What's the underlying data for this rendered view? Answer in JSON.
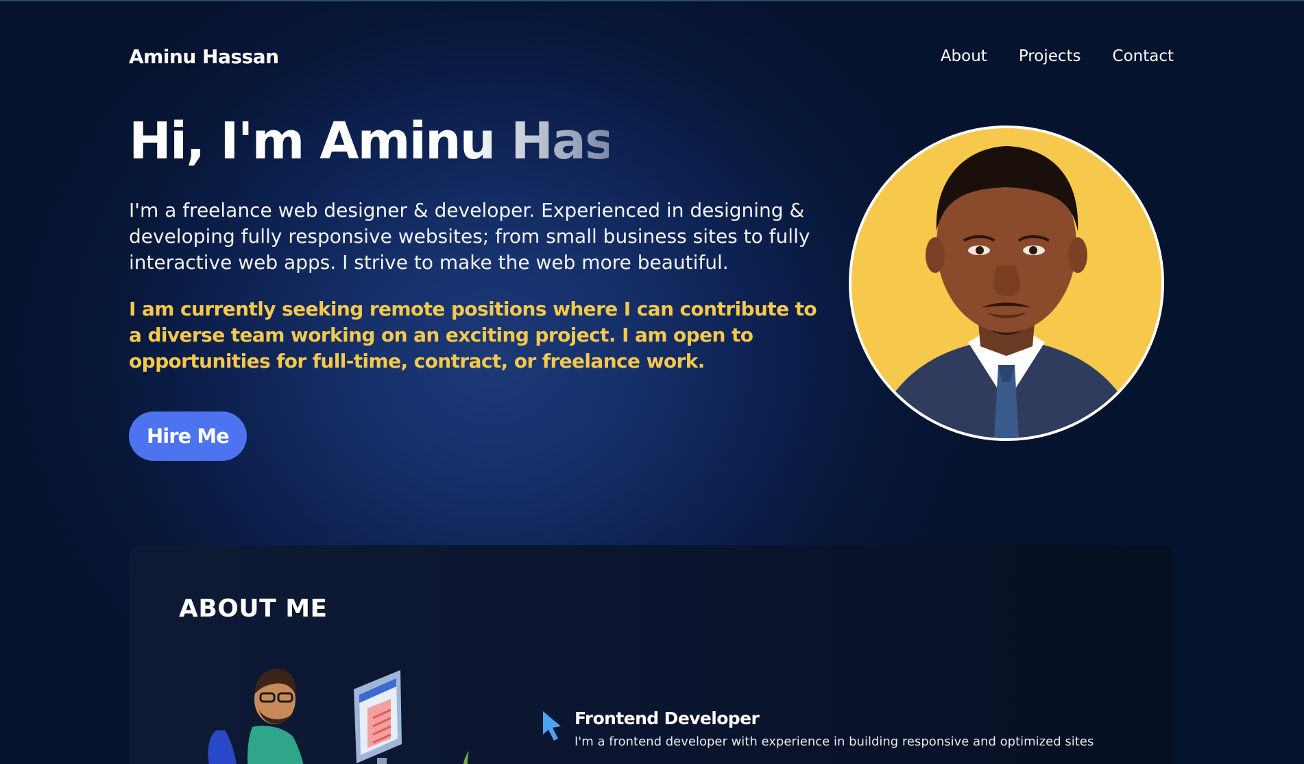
{
  "nav": {
    "brand": "Aminu Hassan",
    "links": [
      {
        "label": "About"
      },
      {
        "label": "Projects"
      },
      {
        "label": "Contact"
      }
    ]
  },
  "hero": {
    "title": "Hi, I'm Aminu Hassan",
    "intro": "I'm a freelance web designer & developer. Experienced in designing & developing fully responsive websites; from small business sites to fully interactive web apps. I strive to make the web more beautiful.",
    "seeking": "I am currently seeking remote positions where I can contribute to a diverse team working on an exciting project. I am open to opportunities for full-time, contract, or freelance work.",
    "cta_label": "Hire Me"
  },
  "about": {
    "heading": "ABOUT ME",
    "roles": [
      {
        "icon": "cursor-icon",
        "title": "Frontend Developer",
        "description": "I'm a frontend developer with experience in building responsive and optimized sites"
      }
    ]
  },
  "colors": {
    "accent_button": "#4e73f0",
    "highlight_text": "#f6c94c",
    "background_dark": "#05132e",
    "card_background": "#0b1530",
    "cursor_icon": "#4aa3f5"
  }
}
